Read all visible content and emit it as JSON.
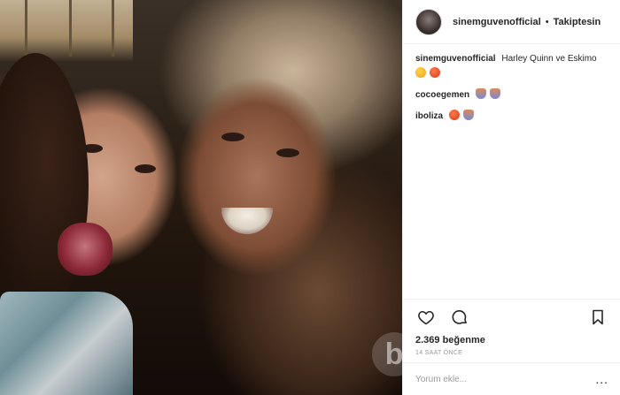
{
  "header": {
    "username": "sinemguvenofficial",
    "separator": "•",
    "follow_label": "Takiptesin"
  },
  "comments": [
    {
      "user": "sinemguvenofficial",
      "text": "Harley Quinn ve Eskimo",
      "emojis": [
        "tongue-face-emoji",
        "angry-face-emoji"
      ]
    },
    {
      "user": "cocoegemen",
      "text": "",
      "emojis": [
        "person-emoji",
        "person-emoji"
      ]
    },
    {
      "user": "iboliza",
      "text": "",
      "emojis": [
        "heart-eyes-emoji",
        "person-emoji"
      ]
    }
  ],
  "actions": {
    "like_icon": "heart-icon",
    "comment_icon": "comment-bubble-icon",
    "save_icon": "bookmark-icon"
  },
  "likes_text": "2.369 beğenme",
  "time_text": "14 SAAT ÖNCE",
  "comment_input": {
    "placeholder": "Yorum ekle...",
    "value": ""
  },
  "more_options": "..."
}
